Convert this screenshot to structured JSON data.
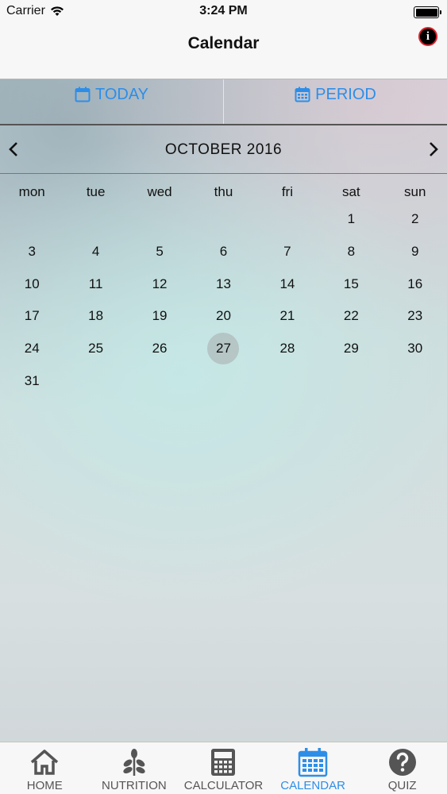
{
  "status_bar": {
    "carrier": "Carrier",
    "time": "3:24 PM"
  },
  "nav": {
    "title": "Calendar",
    "info_icon": "i"
  },
  "segments": [
    {
      "label": "TODAY",
      "icon": "calendar-icon"
    },
    {
      "label": "PERIOD",
      "icon": "calendar-grid-icon"
    }
  ],
  "calendar": {
    "month_label": "OCTOBER 2016",
    "weekdays": [
      "mon",
      "tue",
      "wed",
      "thu",
      "fri",
      "sat",
      "sun"
    ],
    "weeks": [
      [
        "",
        "",
        "",
        "",
        "",
        "1",
        "2"
      ],
      [
        "3",
        "4",
        "5",
        "6",
        "7",
        "8",
        "9"
      ],
      [
        "10",
        "11",
        "12",
        "13",
        "14",
        "15",
        "16"
      ],
      [
        "17",
        "18",
        "19",
        "20",
        "21",
        "22",
        "23"
      ],
      [
        "24",
        "25",
        "26",
        "27",
        "28",
        "29",
        "30"
      ],
      [
        "31",
        "",
        "",
        "",
        "",
        "",
        ""
      ]
    ],
    "selected_day": "27"
  },
  "tabs": [
    {
      "label": "HOME",
      "icon": "home-icon"
    },
    {
      "label": "NUTRITION",
      "icon": "leaf-icon"
    },
    {
      "label": "CALCULATOR",
      "icon": "calculator-icon"
    },
    {
      "label": "CALENDAR",
      "icon": "calendar-icon",
      "active": true
    },
    {
      "label": "QUIZ",
      "icon": "question-icon"
    }
  ],
  "colors": {
    "accent": "#2d8ee8",
    "tab_inactive": "#555555",
    "info_border": "#e0202a"
  }
}
